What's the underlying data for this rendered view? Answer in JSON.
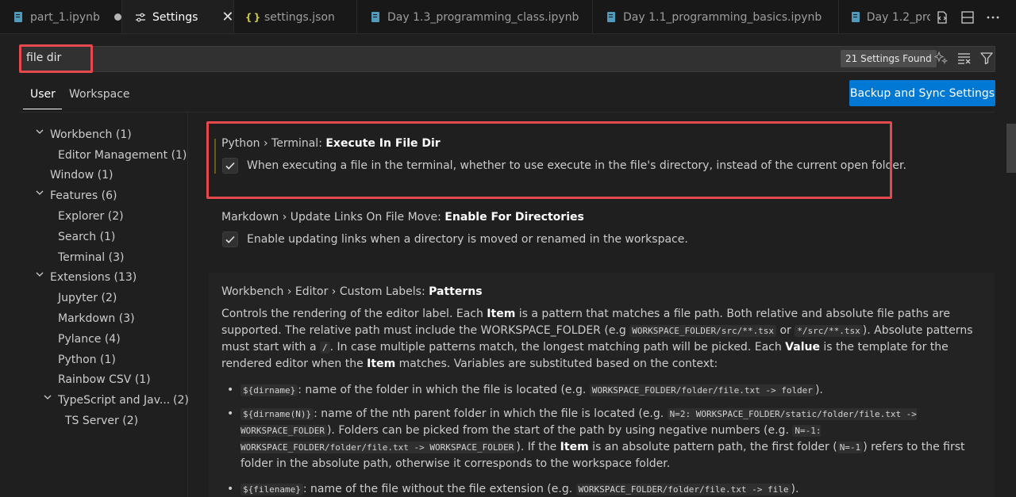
{
  "tabs": [
    {
      "label": "part_1.ipynb",
      "icon": "notebook-icon",
      "dirty": true
    },
    {
      "label": "Settings",
      "icon": "settings-editor-icon",
      "active": true
    },
    {
      "label": "settings.json",
      "icon": "json-braces-icon"
    },
    {
      "label": "Day 1.3_programming_class.ipynb",
      "icon": "notebook-icon"
    },
    {
      "label": "Day 1.1_programming_basics.ipynb",
      "icon": "notebook-icon"
    },
    {
      "label": "Day 1.2_pro",
      "icon": "notebook-icon"
    }
  ],
  "tab_actions": [
    "open-settings-json-icon",
    "split-editor-icon",
    "more-actions-icon"
  ],
  "search": {
    "value": "file dir",
    "results_badge": "21 Settings Found",
    "tools": [
      "ai-search-icon",
      "clear-filter-icon",
      "filter-icon"
    ]
  },
  "scopes": {
    "user": "User",
    "workspace": "Workspace"
  },
  "backup_button": "Backup and Sync Settings",
  "toc": [
    {
      "label": "Workbench",
      "count": "(1)",
      "level": 0,
      "expanded": true
    },
    {
      "label": "Editor Management",
      "count": "(1)",
      "level": 1
    },
    {
      "label": "Window",
      "count": "(1)",
      "level": 0
    },
    {
      "label": "Features",
      "count": "(6)",
      "level": 0,
      "expanded": true
    },
    {
      "label": "Explorer",
      "count": "(2)",
      "level": 1
    },
    {
      "label": "Search",
      "count": "(1)",
      "level": 1
    },
    {
      "label": "Terminal",
      "count": "(3)",
      "level": 1
    },
    {
      "label": "Extensions",
      "count": "(13)",
      "level": 0,
      "expanded": true
    },
    {
      "label": "Jupyter",
      "count": "(2)",
      "level": 1
    },
    {
      "label": "Markdown",
      "count": "(3)",
      "level": 1
    },
    {
      "label": "Pylance",
      "count": "(4)",
      "level": 1
    },
    {
      "label": "Python",
      "count": "(1)",
      "level": 1
    },
    {
      "label": "Rainbow CSV",
      "count": "(1)",
      "level": 1
    },
    {
      "label": "TypeScript and Jav...",
      "count": "(2)",
      "level": 1,
      "expanded": true
    },
    {
      "label": "TS Server",
      "count": "(2)",
      "level": 2
    }
  ],
  "settings": {
    "python_terminal": {
      "category": "Python › Terminal: ",
      "name": "Execute In File Dir",
      "checked": true,
      "description": "When executing a file in the terminal, whether to use execute in the file's directory, instead of the current open folder."
    },
    "markdown_links": {
      "category": "Markdown › Update Links On File Move: ",
      "name": "Enable For Directories",
      "checked": true,
      "description": "Enable updating links when a directory is moved or renamed in the workspace."
    },
    "custom_labels": {
      "category": "Workbench › Editor › Custom Labels: ",
      "name": "Patterns",
      "p1": [
        "Controls the rendering of the editor label. Each ",
        "Item",
        " is a pattern that matches a file path. Both relative and absolute file paths are supported. The relative path must include the WORKSPACE_FOLDER (e.g ",
        "WORKSPACE_FOLDER/src/**.tsx",
        " or ",
        "*/src/**.tsx",
        "). Absolute patterns must start with a ",
        "/",
        ". In case multiple patterns match, the longest matching path will be picked. Each ",
        "Value",
        " is the template for the rendered editor when the ",
        "Item",
        " matches. Variables are substituted based on the context:"
      ],
      "b1": [
        "${dirname}",
        ": name of the folder in which the file is located (e.g. ",
        "WORKSPACE_FOLDER/folder/file.txt -> folder",
        ")."
      ],
      "b2": [
        "${dirname(N)}",
        ": name of the nth parent folder in which the file is located (e.g. ",
        "N=2: WORKSPACE_FOLDER/static/folder/file.txt -> WORKSPACE_FOLDER",
        "). Folders can be picked from the start of the path by using negative numbers (e.g. ",
        "N=-1: WORKSPACE_FOLDER/folder/file.txt -> WORKSPACE_FOLDER",
        "). If the ",
        "Item",
        " is an absolute pattern path, the first folder (",
        "N=-1",
        ") refers to the first folder in the absolute path, otherwise it corresponds to the workspace folder."
      ],
      "b3": [
        "${filename}",
        ": name of the file without the file extension (e.g. ",
        "WORKSPACE_FOLDER/folder/file.txt -> file",
        ")."
      ]
    }
  },
  "colors": {
    "accent": "#0078d4",
    "highlight_box": "#e5484d",
    "background": "#1f1f1f"
  }
}
